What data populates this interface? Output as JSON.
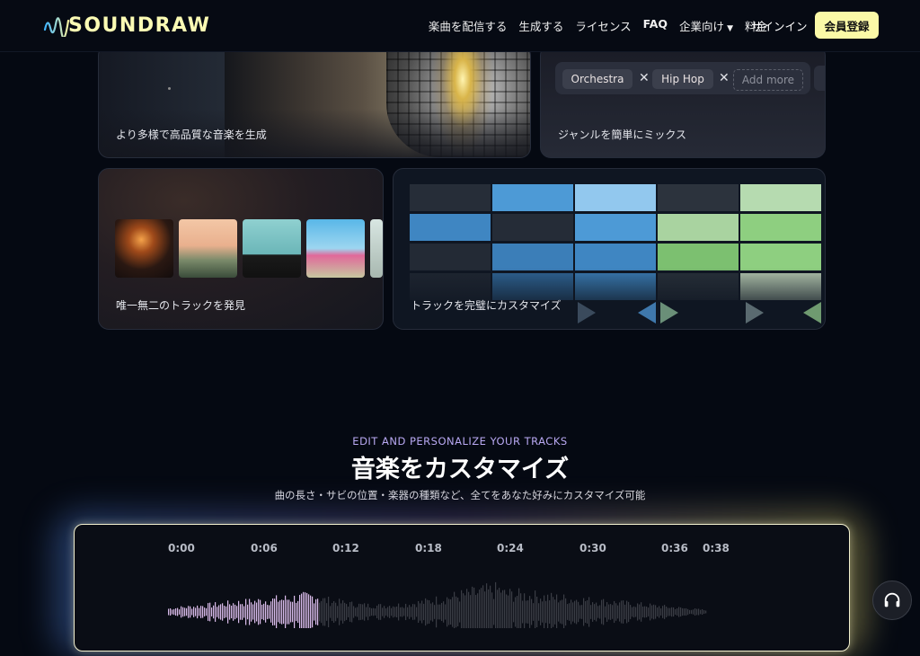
{
  "brand": {
    "name": "SOUNDRAW"
  },
  "nav": {
    "items": [
      "楽曲を配信する",
      "生成する",
      "ライセンス",
      "FAQ",
      "企業向け",
      "料金"
    ],
    "signin": "サインイン",
    "signup": "会員登録"
  },
  "cards": {
    "card1": {
      "label": "より多様で高品質な音楽を生成"
    },
    "card2": {
      "label": "ジャンルを簡単にミックス",
      "tags": [
        "Orchestra",
        "Hip Hop"
      ],
      "add_more": "Add more"
    },
    "card3": {
      "label": "唯一無二のトラックを発見"
    },
    "card4": {
      "label": "トラックを完璧にカスタマイズ"
    }
  },
  "section": {
    "eyebrow": "EDIT AND PERSONALIZE YOUR TRACKS",
    "title": "音楽をカスタマイズ",
    "subtitle": "曲の長さ・サビの位置・楽器の種類など、全てをあなた好みにカスタマイズ可能"
  },
  "editor": {
    "timeline": [
      "0:00",
      "0:06",
      "0:12",
      "0:18",
      "0:24",
      "0:30",
      "0:36",
      "0:38"
    ]
  },
  "colors": {
    "accent": "#fbf9a7",
    "eyebrow": "#b9a9f3"
  },
  "icons": {
    "support": "headset-icon",
    "remove": "close-icon",
    "dropdown": "chevron-down-icon"
  }
}
